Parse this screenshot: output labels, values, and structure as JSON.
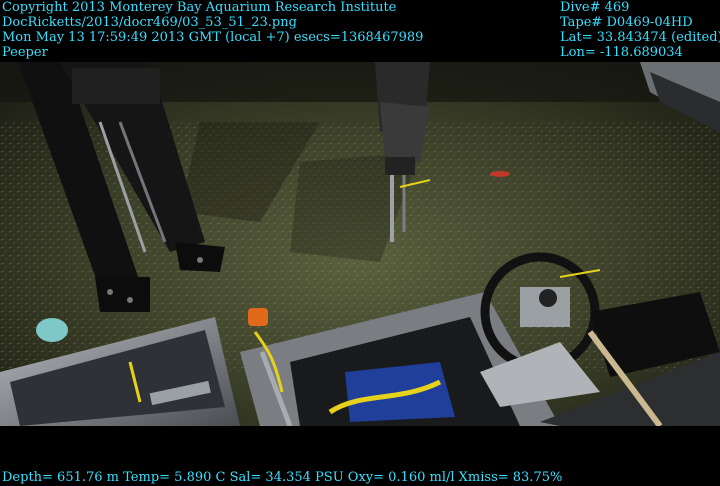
{
  "overlay": {
    "top_left": [
      "Copyright 2013 Monterey Bay Aquarium Research Institute",
      "DocRicketts/2013/docr469/03_53_51_23.png",
      "Mon May 13 17:59:49 2013 GMT (local +7)  esecs=1368467989",
      "Peeper"
    ],
    "top_right": [
      "Dive# 469",
      "Tape# D0469-04HD",
      "Lat= 33.843474 (edited)",
      "Lon= -118.689034"
    ],
    "bottom": "Depth= 651.76 m  Temp= 5.890 C  Sal= 34.354 PSU  Oxy= 0.160 ml/l  Xmiss= 83.75%"
  },
  "colors": {
    "overlay_text": "#36e0ff",
    "seafloor": "#3a3d28",
    "frame_metal": "#8a8f94",
    "tray_blue": "#1f3f9a",
    "rope_yellow": "#e6d21a",
    "float_orange": "#e06a1a"
  },
  "scene": {
    "description_icons": [
      "rov-manipulator-arm",
      "sampling-frame",
      "seafloor-sediment",
      "drawer-tray",
      "rope-bundle",
      "sensor-gimbal"
    ]
  }
}
